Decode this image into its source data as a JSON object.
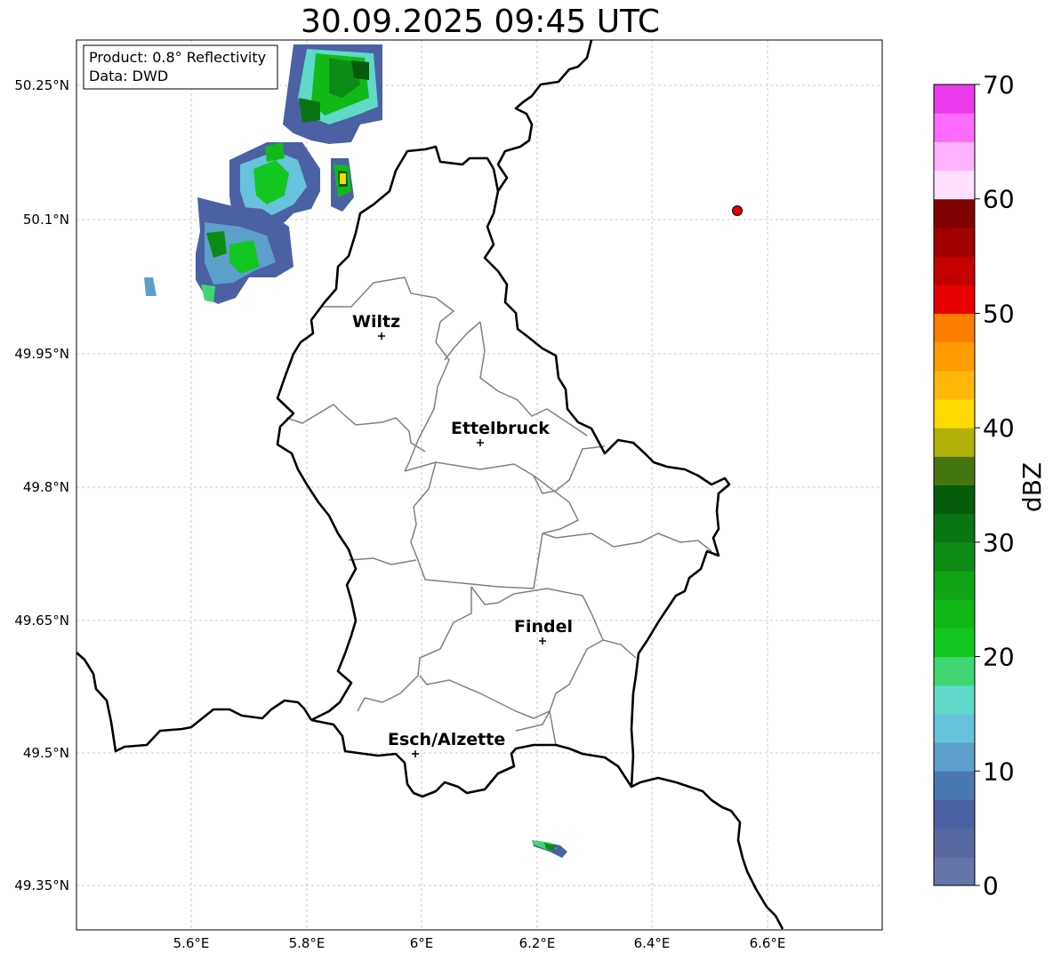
{
  "title": "30.09.2025 09:45 UTC",
  "info_box": {
    "product": "Product: 0.8° Reflectivity",
    "data": "Data: DWD"
  },
  "axes": {
    "lat_ticks": [
      "50.25°N",
      "50.1°N",
      "49.95°N",
      "49.8°N",
      "49.65°N",
      "49.5°N",
      "49.35°N"
    ],
    "lon_ticks": [
      "5.6°E",
      "5.8°E",
      "6°E",
      "6.2°E",
      "6.4°E",
      "6.6°E"
    ]
  },
  "cities": [
    {
      "name": "Wiltz"
    },
    {
      "name": "Ettelbruck"
    },
    {
      "name": "Findel"
    },
    {
      "name": "Esch/Alzette"
    }
  ],
  "colorbar": {
    "label": "dBZ",
    "ticks": [
      "0",
      "10",
      "20",
      "30",
      "40",
      "50",
      "60",
      "70"
    ],
    "colors": [
      "#6575a8",
      "#5767a0",
      "#4b61a3",
      "#4a79b2",
      "#5c9fca",
      "#67c2dc",
      "#5fd9c8",
      "#40d672",
      "#13c721",
      "#12b917",
      "#10a316",
      "#0c8c14",
      "#097511",
      "#055c0c",
      "#457510",
      "#b1b209",
      "#ffd900",
      "#ffb80a",
      "#ff9c00",
      "#ff7d00",
      "#e60000",
      "#c40000",
      "#a00000",
      "#7f0000",
      "#ffe0ff",
      "#ffb3ff",
      "#ff6aff",
      "#eb3aeb"
    ]
  },
  "colors": {
    "border": "#000000",
    "canton": "#808080",
    "grid": "#bbbbbb",
    "marker": "#dd0000"
  }
}
